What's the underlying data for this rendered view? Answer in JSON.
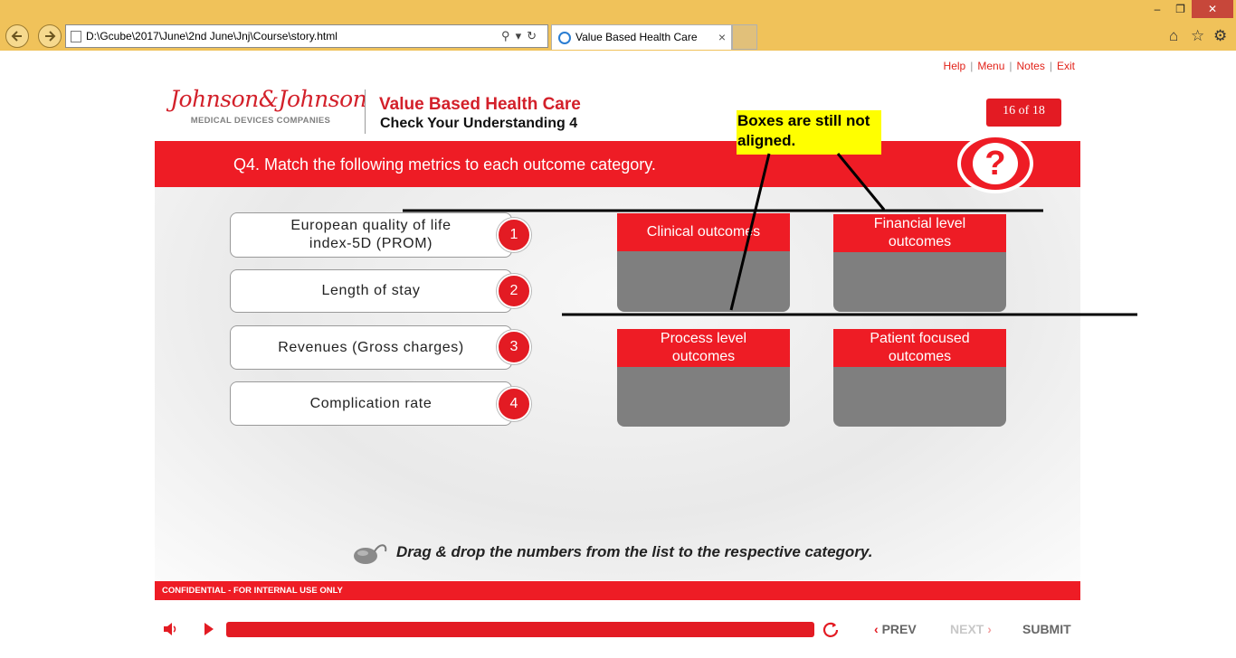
{
  "browser": {
    "url": "D:\\Gcube\\2017\\June\\2nd June\\Jnj\\Course\\story.html",
    "tab_title": "Value Based Health Care",
    "tab_close": "×",
    "window_controls": [
      "–",
      "❐",
      "✕"
    ],
    "right_icons": [
      "home-icon",
      "favorites-star-icon",
      "settings-gear-icon"
    ]
  },
  "top_links": [
    "Help",
    "Menu",
    "Notes",
    "Exit"
  ],
  "header": {
    "logo_script": "Johnson&Johnson",
    "logo_sub": "MEDICAL DEVICES COMPANIES",
    "course_title": "Value Based Health Care",
    "course_sub": "Check Your Understanding 4",
    "page_counter": "16 of 18"
  },
  "question": {
    "text": "Q4. Match the following metrics to each outcome category.",
    "icon_glyph": "?"
  },
  "metrics": [
    {
      "label": "European quality of life index-5D (PROM)",
      "number": "1"
    },
    {
      "label": "Length of stay",
      "number": "2"
    },
    {
      "label": "Revenues (Gross charges)",
      "number": "3"
    },
    {
      "label": "Complication rate",
      "number": "4"
    }
  ],
  "categories": [
    {
      "label": "Clinical outcomes"
    },
    {
      "label": "Financial level outcomes"
    },
    {
      "label": "Process level outcomes"
    },
    {
      "label": "Patient focused outcomes"
    }
  ],
  "instruction": "Drag & drop the numbers from the list to the respective category.",
  "confidential": "CONFIDENTIAL - FOR INTERNAL USE ONLY",
  "player": {
    "prev": "PREV",
    "next": "NEXT",
    "submit": "SUBMIT",
    "progress": 1.0,
    "colors": {
      "accent": "#e31b23",
      "disabled": "#c8c8c8",
      "nav_text": "#666666"
    }
  },
  "annotation": {
    "text": "Boxes are still not aligned.",
    "color": "#ffff00"
  }
}
